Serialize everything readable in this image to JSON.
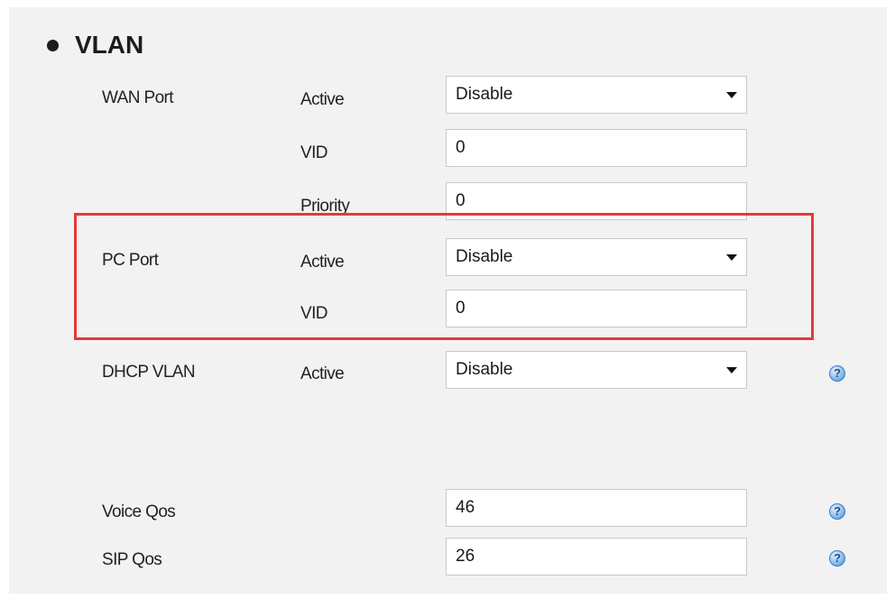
{
  "section": {
    "title": "VLAN"
  },
  "wan_port": {
    "label": "WAN Port",
    "active_label": "Active",
    "active_value": "Disable",
    "vid_label": "VID",
    "vid_value": "0",
    "priority_label": "Priority",
    "priority_value": "0"
  },
  "pc_port": {
    "label": "PC Port",
    "active_label": "Active",
    "active_value": "Disable",
    "vid_label": "VID",
    "vid_value": "0"
  },
  "dhcp_vlan": {
    "label": "DHCP VLAN",
    "active_label": "Active",
    "active_value": "Disable"
  },
  "voice_qos": {
    "label": "Voice Qos",
    "value": "46"
  },
  "sip_qos": {
    "label": "SIP Qos",
    "value": "26"
  },
  "help_icon_glyph": "?",
  "colors": {
    "background": "#f2f2f2",
    "highlight_border": "#e8383a",
    "help_icon": "#4a8fd6"
  }
}
